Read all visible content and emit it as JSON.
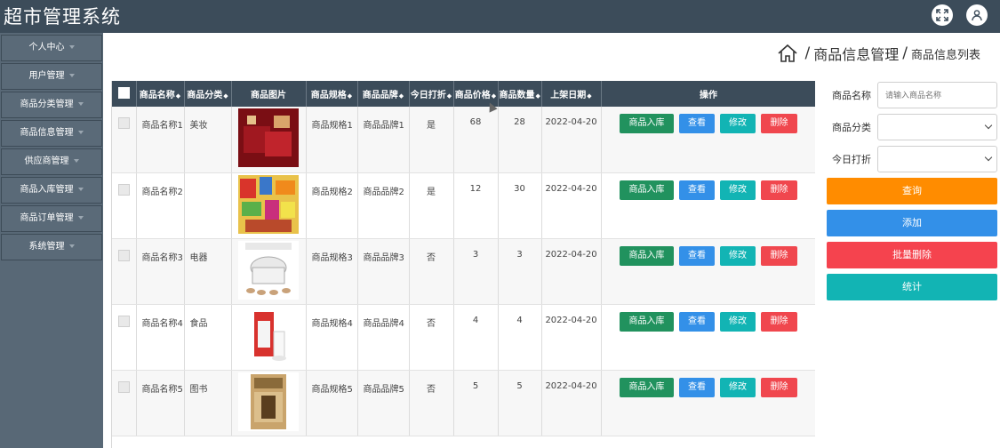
{
  "app": {
    "title": "超市管理系统"
  },
  "topbar": {
    "fullscreen_icon": "expand-icon",
    "user_icon": "user-icon"
  },
  "sidebar": {
    "items": [
      {
        "label": "个人中心"
      },
      {
        "label": "用户管理"
      },
      {
        "label": "商品分类管理"
      },
      {
        "label": "商品信息管理"
      },
      {
        "label": "供应商管理"
      },
      {
        "label": "商品入库管理"
      },
      {
        "label": "商品订单管理"
      },
      {
        "label": "系统管理"
      }
    ]
  },
  "breadcrumb": {
    "home_icon": "home-icon",
    "level1": "商品信息管理",
    "level2": "商品信息列表",
    "sep": "/"
  },
  "table": {
    "headers": [
      "商品名称",
      "商品分类",
      "商品图片",
      "商品规格",
      "商品品牌",
      "今日打折",
      "商品价格",
      "商品数量",
      "上架日期",
      "操作"
    ],
    "sort_mark": "◆",
    "rows": [
      {
        "name": "商品名称1",
        "category": "美妆",
        "spec": "商品规格1",
        "brand": "商品品牌1",
        "discount": "是",
        "price": "68",
        "qty": "28",
        "date": "2022-04-20",
        "image": "cosmetics-gift-box"
      },
      {
        "name": "商品名称2",
        "category": "",
        "spec": "商品规格2",
        "brand": "商品品牌2",
        "discount": "是",
        "price": "12",
        "qty": "30",
        "date": "2022-04-20",
        "image": "snacks-assortment"
      },
      {
        "name": "商品名称3",
        "category": "电器",
        "spec": "商品规格3",
        "brand": "商品品牌3",
        "discount": "否",
        "price": "3",
        "qty": "3",
        "date": "2022-04-20",
        "image": "rice-cooker"
      },
      {
        "name": "商品名称4",
        "category": "食品",
        "spec": "商品规格4",
        "brand": "商品品牌4",
        "discount": "否",
        "price": "4",
        "qty": "4",
        "date": "2022-04-20",
        "image": "milk-carton"
      },
      {
        "name": "商品名称5",
        "category": "图书",
        "spec": "商品规格5",
        "brand": "商品品牌5",
        "discount": "否",
        "price": "5",
        "qty": "5",
        "date": "2022-04-20",
        "image": "book-box"
      }
    ],
    "actions": {
      "stock_in": "商品入库",
      "view": "查看",
      "edit": "修改",
      "delete": "删除"
    }
  },
  "search_panel": {
    "name_label": "商品名称",
    "name_placeholder": "请输入商品名称",
    "category_label": "商品分类",
    "category_value": "",
    "discount_label": "今日打折",
    "discount_value": "",
    "query_button": "查询",
    "add_button": "添加",
    "batch_delete_button": "批量删除",
    "stats_button": "统计"
  },
  "colors": {
    "topbar": "#3c4c5a",
    "sidebar": "#586876",
    "stock_in": "#21925e",
    "view": "#3390e8",
    "edit": "#12b4b4",
    "delete": "#f0474e",
    "query": "#ff8c00"
  }
}
